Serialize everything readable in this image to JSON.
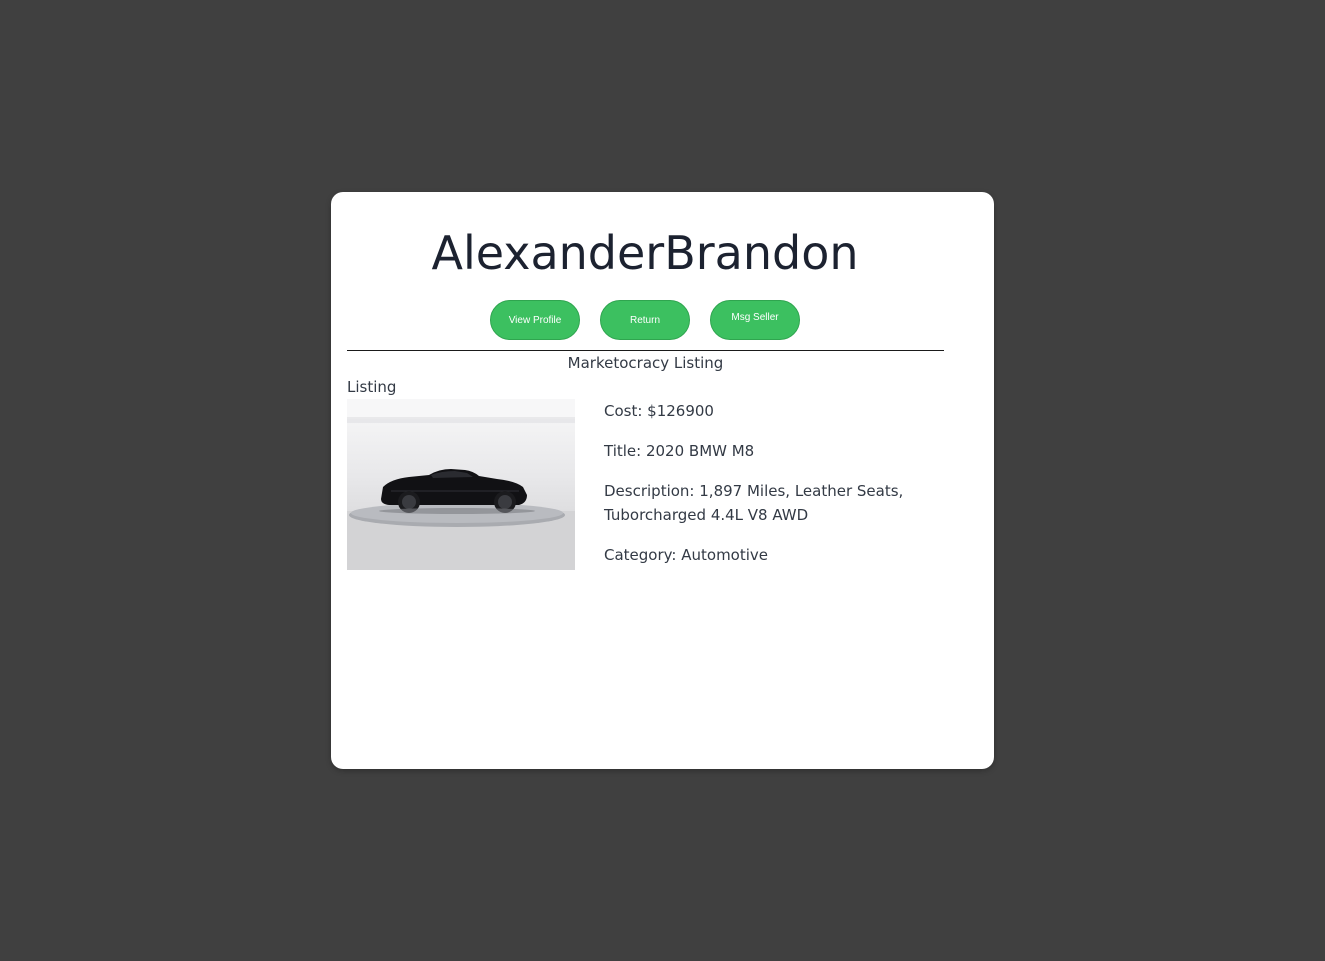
{
  "profile": {
    "username": "AlexanderBrandon"
  },
  "actions": {
    "view_profile_label": "View Profile",
    "return_label": "Return",
    "msg_seller_label": "Msg Seller",
    "button_color": "#3cc060"
  },
  "section": {
    "title": "Marketocracy Listing",
    "listing_label": "Listing"
  },
  "listing": {
    "image_alt": "black convertible car on display turntable",
    "cost": "Cost: $126900",
    "title": "Title: 2020 BMW M8",
    "description": "Description: 1,897 Miles, Leather Seats, Tuborcharged 4.4L V8 AWD",
    "category": "Category: Automotive"
  },
  "colors": {
    "background": "#404040",
    "card": "#ffffff",
    "text": "#333a45"
  }
}
